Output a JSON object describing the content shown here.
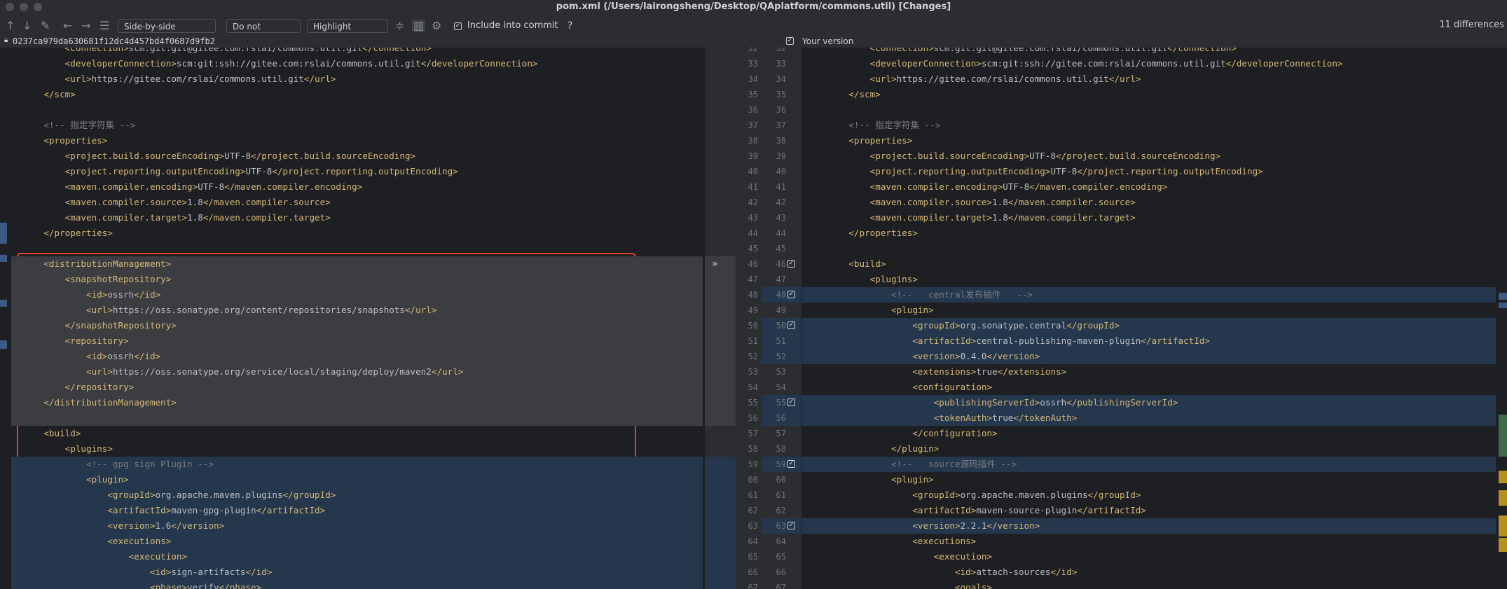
{
  "window": {
    "title": "pom.xml (/Users/lairongsheng/Desktop/QAplatform/commons.util) [Changes]"
  },
  "toolbar": {
    "viewer": "Side-by-side viewer",
    "ignore": "Do not ignore",
    "highlight": "Highlight words",
    "include_label": "Include into commit",
    "help": "?",
    "differences": "11 differences",
    "icons": [
      "arrow-up-icon",
      "arrow-down-icon",
      "edit-icon",
      "arrow-left-icon",
      "arrow-right-icon",
      "list-icon",
      "collapse-icon",
      "columns-icon",
      "gear-icon"
    ]
  },
  "left_header": {
    "hash": "0237ca979da630681f12dc4d457bd4f0687d9fb2"
  },
  "right_header": {
    "label": "Your version"
  },
  "colors": {
    "background": "#1e1f22",
    "tag": "#d5b778",
    "comment": "#7a7e85",
    "modified": "#25374d",
    "deleted": "#3c3d40",
    "highlight": "#e0402f"
  },
  "left_lines": [
    {
      "text": "        <connection>scm:git:git@gitee.com:rslai/commons.util.git</connection>",
      "type": "normal"
    },
    {
      "text": "        <developerConnection>scm:git:ssh://gitee.com:rslai/commons.util.git</developerConnection>",
      "type": "normal"
    },
    {
      "text": "        <url>https://gitee.com/rslai/commons.util.git</url>",
      "type": "normal"
    },
    {
      "text": "    </scm>",
      "type": "normal"
    },
    {
      "text": "",
      "type": "normal"
    },
    {
      "text": "    <!-- 指定字符集 -->",
      "type": "normal"
    },
    {
      "text": "    <properties>",
      "type": "normal"
    },
    {
      "text": "        <project.build.sourceEncoding>UTF-8</project.build.sourceEncoding>",
      "type": "normal"
    },
    {
      "text": "        <project.reporting.outputEncoding>UTF-8</project.reporting.outputEncoding>",
      "type": "normal"
    },
    {
      "text": "        <maven.compiler.encoding>UTF-8</maven.compiler.encoding>",
      "type": "normal"
    },
    {
      "text": "        <maven.compiler.source>1.8</maven.compiler.source>",
      "type": "normal"
    },
    {
      "text": "        <maven.compiler.target>1.8</maven.compiler.target>",
      "type": "normal"
    },
    {
      "text": "    </properties>",
      "type": "normal"
    },
    {
      "text": "",
      "type": "normal"
    },
    {
      "text": "    <distributionManagement>",
      "type": "del"
    },
    {
      "text": "        <snapshotRepository>",
      "type": "del"
    },
    {
      "text": "            <id>ossrh</id>",
      "type": "del"
    },
    {
      "text": "            <url>https://oss.sonatype.org/content/repositories/snapshots</url>",
      "type": "del"
    },
    {
      "text": "        </snapshotRepository>",
      "type": "del"
    },
    {
      "text": "        <repository>",
      "type": "del"
    },
    {
      "text": "            <id>ossrh</id>",
      "type": "del"
    },
    {
      "text": "            <url>https://oss.sonatype.org/service/local/staging/deploy/maven2</url>",
      "type": "del"
    },
    {
      "text": "        </repository>",
      "type": "del"
    },
    {
      "text": "    </distributionManagement>",
      "type": "del"
    },
    {
      "text": "",
      "type": "del"
    },
    {
      "text": "    <build>",
      "type": "normal"
    },
    {
      "text": "        <plugins>",
      "type": "normal"
    },
    {
      "text": "            <!-- gpg sign Plugin -->",
      "type": "mod"
    },
    {
      "text": "            <plugin>",
      "type": "mod"
    },
    {
      "text": "                <groupId>org.apache.maven.plugins</groupId>",
      "type": "mod"
    },
    {
      "text": "                <artifactId>maven-gpg-plugin</artifactId>",
      "type": "mod"
    },
    {
      "text": "                <version>1.6</version>",
      "type": "mod"
    },
    {
      "text": "                <executions>",
      "type": "mod"
    },
    {
      "text": "                    <execution>",
      "type": "mod"
    },
    {
      "text": "                        <id>sign-artifacts</id>",
      "type": "mod"
    },
    {
      "text": "                        <phase>verify</phase>",
      "type": "mod"
    }
  ],
  "right_lines": [
    {
      "num": "32",
      "text": "        <connection>scm:git:git@gitee.com:rslai/commons.util.git</connection>",
      "type": "normal"
    },
    {
      "num": "33",
      "text": "        <developerConnection>scm:git:ssh://gitee.com:rslai/commons.util.git</developerConnection>",
      "type": "normal"
    },
    {
      "num": "34",
      "text": "        <url>https://gitee.com/rslai/commons.util.git</url>",
      "type": "normal"
    },
    {
      "num": "35",
      "text": "    </scm>",
      "type": "normal"
    },
    {
      "num": "36",
      "text": "",
      "type": "normal"
    },
    {
      "num": "37",
      "text": "    <!-- 指定字符集 -->",
      "type": "normal"
    },
    {
      "num": "38",
      "text": "    <properties>",
      "type": "normal"
    },
    {
      "num": "39",
      "text": "        <project.build.sourceEncoding>UTF-8</project.build.sourceEncoding>",
      "type": "normal"
    },
    {
      "num": "40",
      "text": "        <project.reporting.outputEncoding>UTF-8</project.reporting.outputEncoding>",
      "type": "normal"
    },
    {
      "num": "41",
      "text": "        <maven.compiler.encoding>UTF-8</maven.compiler.encoding>",
      "type": "normal"
    },
    {
      "num": "42",
      "text": "        <maven.compiler.source>1.8</maven.compiler.source>",
      "type": "normal"
    },
    {
      "num": "43",
      "text": "        <maven.compiler.target>1.8</maven.compiler.target>",
      "type": "normal"
    },
    {
      "num": "44",
      "text": "    </properties>",
      "type": "normal"
    },
    {
      "num": "45",
      "text": "",
      "type": "normal"
    },
    {
      "num": "46",
      "text": "    <build>",
      "type": "normal",
      "chk": true
    },
    {
      "num": "47",
      "text": "        <plugins>",
      "type": "normal"
    },
    {
      "num": "48",
      "text": "            <!--   central发布插件   -->",
      "type": "mod",
      "chk": true
    },
    {
      "num": "49",
      "text": "            <plugin>",
      "type": "normal"
    },
    {
      "num": "50",
      "text": "                <groupId>org.sonatype.central</groupId>",
      "type": "mod",
      "chk": true
    },
    {
      "num": "51",
      "text": "                <artifactId>central-publishing-maven-plugin</artifactId>",
      "type": "mod"
    },
    {
      "num": "52",
      "text": "                <version>0.4.0</version>",
      "type": "mod"
    },
    {
      "num": "53",
      "text": "                <extensions>true</extensions>",
      "type": "normal"
    },
    {
      "num": "54",
      "text": "                <configuration>",
      "type": "normal"
    },
    {
      "num": "55",
      "text": "                    <publishingServerId>ossrh</publishingServerId>",
      "type": "mod",
      "chk": true
    },
    {
      "num": "56",
      "text": "                    <tokenAuth>true</tokenAuth>",
      "type": "mod"
    },
    {
      "num": "57",
      "text": "                </configuration>",
      "type": "normal"
    },
    {
      "num": "58",
      "text": "            </plugin>",
      "type": "normal"
    },
    {
      "num": "59",
      "text": "            <!--   source源码插件 -->",
      "type": "mod",
      "chk": true
    },
    {
      "num": "60",
      "text": "            <plugin>",
      "type": "normal"
    },
    {
      "num": "61",
      "text": "                <groupId>org.apache.maven.plugins</groupId>",
      "type": "normal"
    },
    {
      "num": "62",
      "text": "                <artifactId>maven-source-plugin</artifactId>",
      "type": "normal"
    },
    {
      "num": "63",
      "text": "                <version>2.2.1</version>",
      "type": "mod",
      "chk": true
    },
    {
      "num": "64",
      "text": "                <executions>",
      "type": "normal"
    },
    {
      "num": "65",
      "text": "                    <execution>",
      "type": "normal"
    },
    {
      "num": "66",
      "text": "                        <id>attach-sources</id>",
      "type": "normal"
    },
    {
      "num": "67",
      "text": "                        <goals>",
      "type": "normal"
    }
  ]
}
